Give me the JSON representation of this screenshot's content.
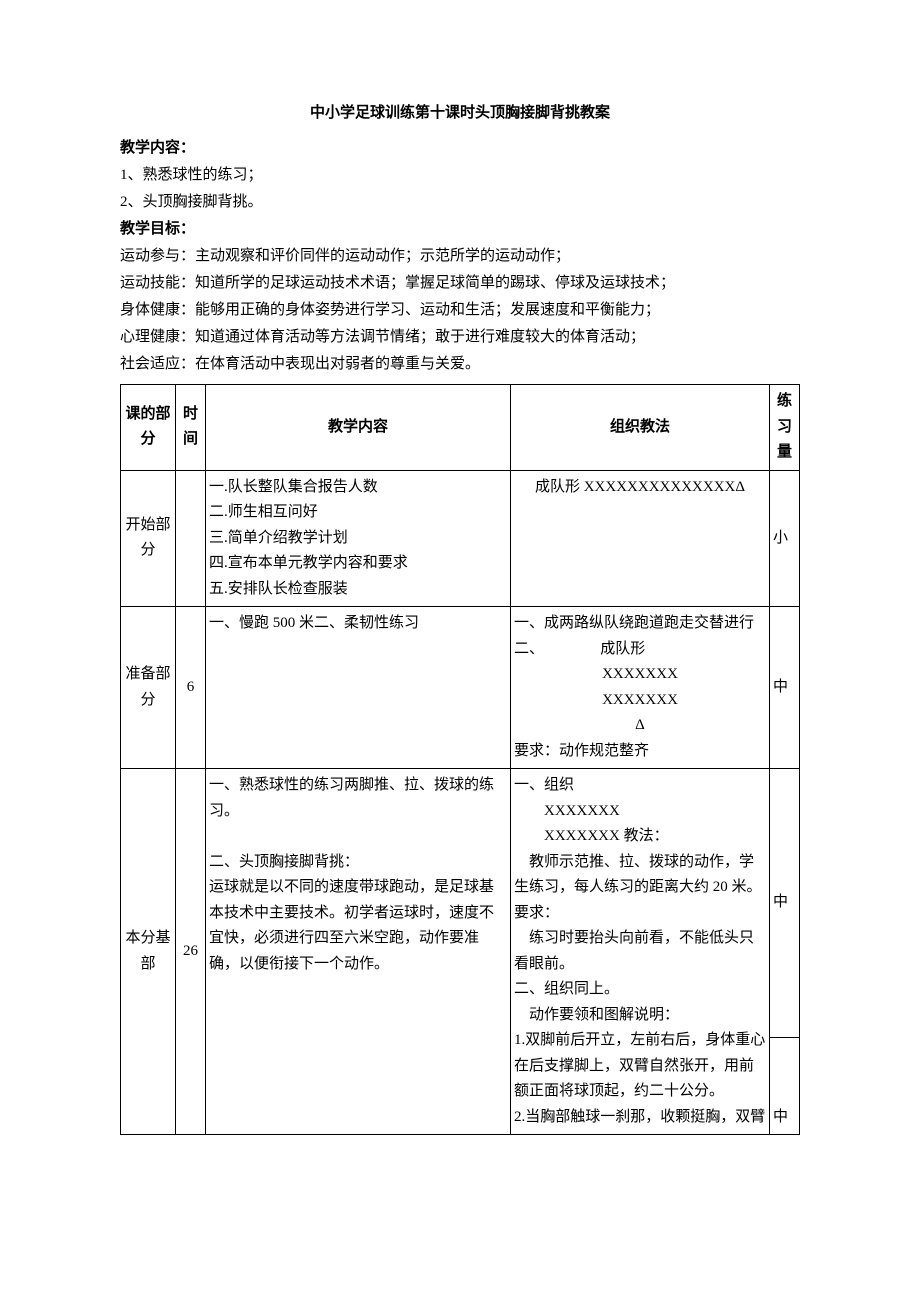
{
  "title": "中小学足球训练第十课时头顶胸接脚背挑教案",
  "contentHeader": "教学内容：",
  "contentLines": [
    "1、熟悉球性的练习；",
    "2、头顶胸接脚背挑。"
  ],
  "goalHeader": "教学目标：",
  "goalLines": [
    "运动参与：主动观察和评价同伴的运动动作；示范所学的运动动作；",
    "运动技能：知道所学的足球运动技术术语；掌握足球简单的踢球、停球及运球技术；",
    "身体健康：能够用正确的身体姿势进行学习、运动和生活；发展速度和平衡能力；",
    "心理健康：知道通过体育活动等方法调节情绪；敢于进行难度较大的体育活动；",
    "社会适应：在体育活动中表现出对弱者的尊重与关爱。"
  ],
  "table": {
    "headers": {
      "part": "课的部分",
      "time": "时间",
      "content": "教学内容",
      "method": "组织教法",
      "load": "练习量"
    },
    "rows": [
      {
        "part": "开始部分",
        "time": "",
        "content": "一.队长整队集合报告人数\n二.师生相互问好\n三.简单介绍教学计划\n四.宣布本单元教学内容和要求\n五.安排队长检查服装",
        "methodLines": [
          {
            "t": "成队形 XXXXXXXXXXXXXXΔ",
            "cls": "center"
          }
        ],
        "load": "小"
      },
      {
        "part": "准备部分",
        "time": "6",
        "content": "一、慢跑 500 米二、柔韧性练习",
        "methodLines": [
          {
            "t": "一、成两路纵队绕跑道跑走交替进行",
            "cls": ""
          },
          {
            "t": "二、               成队形",
            "cls": ""
          },
          {
            "t": "XXXXXXX",
            "cls": "center"
          },
          {
            "t": "XXXXXXX",
            "cls": "center"
          },
          {
            "t": "Δ",
            "cls": "center"
          },
          {
            "t": "要求：动作规范整齐",
            "cls": ""
          }
        ],
        "load": "中"
      },
      {
        "part": "本分基部",
        "time": "26",
        "content": "一、熟悉球性的练习两脚推、拉、拨球的练习。\n\n二、头顶胸接脚背挑：\n运球就是以不同的速度带球跑动，是足球基本技术中主要技术。初学者运球时，速度不宜快，必须进行四至六米空跑，动作要准确，以便衔接下一个动作。",
        "methodLines": [
          {
            "t": "一、组织",
            "cls": ""
          },
          {
            "t": "XXXXXXX",
            "cls": "indent1"
          },
          {
            "t": "XXXXXXX 教法：",
            "cls": "indent1"
          },
          {
            "t": "    教师示范推、拉、拨球的动作，学生练习，每人练习的距离大约 20 米。",
            "cls": ""
          },
          {
            "t": "要求：",
            "cls": ""
          },
          {
            "t": "    练习时要抬头向前看，不能低头只看眼前。",
            "cls": ""
          },
          {
            "t": "二、组织同上。",
            "cls": ""
          },
          {
            "t": "    动作要领和图解说明：",
            "cls": ""
          },
          {
            "t": "1.双脚前后开立，左前右后，身体重心在后支撑脚上，双臂自然张开，用前额正面将球顶起，约二十公分。",
            "cls": ""
          },
          {
            "t": "2.当胸部触球一刹那，收颗挺胸，双臂",
            "cls": ""
          }
        ],
        "load": "中",
        "load2": "中"
      }
    ]
  }
}
